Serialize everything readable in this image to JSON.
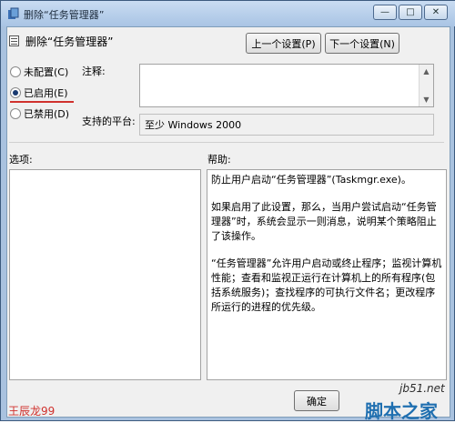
{
  "window": {
    "title": "删除“任务管理器”",
    "min_glyph": "—",
    "max_glyph": "□",
    "close_glyph": "✕"
  },
  "header": {
    "title": "删除“任务管理器”"
  },
  "nav": {
    "prev_label": "上一个设置(P)",
    "next_label": "下一个设置(N)"
  },
  "state": {
    "options": [
      {
        "label": "未配置(C)",
        "selected": false
      },
      {
        "label": "已启用(E)",
        "selected": true
      },
      {
        "label": "已禁用(D)",
        "selected": false
      }
    ]
  },
  "labels": {
    "comment": "注释:",
    "platform": "支持的平台:",
    "options": "选项:",
    "help": "帮助:"
  },
  "platform_value": "至少 Windows 2000",
  "help_text": [
    "防止用户启动“任务管理器”(Taskmgr.exe)。",
    "如果启用了此设置，那么，当用户尝试启动“任务管理器”时，系统会显示一则消息，说明某个策略阻止了该操作。",
    "“任务管理器”允许用户启动或终止程序；监视计算机性能；查看和监视正运行在计算机上的所有程序(包括系统服务)；查找程序的可执行文件名；更改程序所运行的进程的优先级。"
  ],
  "footer": {
    "ok_label": "确定"
  },
  "overlays": {
    "watermark": "王辰龙99",
    "site_url": "jb51.net",
    "site_name": "脚本之家"
  }
}
